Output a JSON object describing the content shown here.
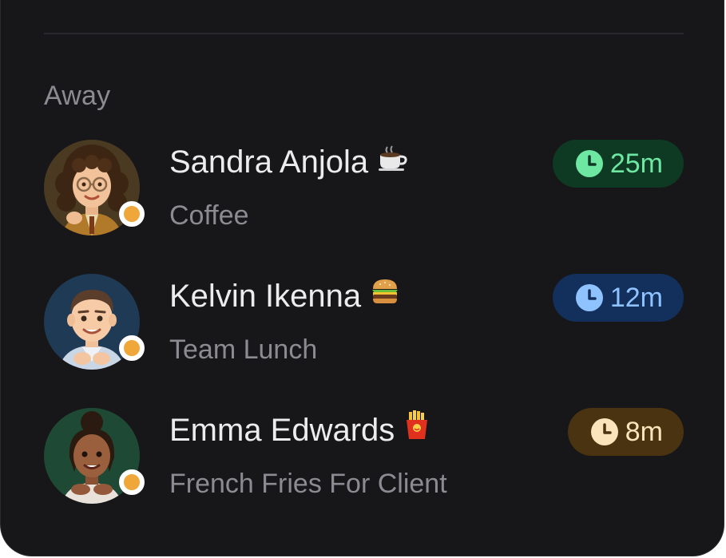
{
  "section": {
    "title": "Away"
  },
  "people": [
    {
      "name": "Sandra Anjola",
      "emoji": "coffee-emoji",
      "status": "Coffee",
      "duration": "25m",
      "pill_bg": "#0e3a24",
      "pill_fg": "#6ee7a2",
      "status_color": "#f0a73a"
    },
    {
      "name": "Kelvin Ikenna",
      "emoji": "burger-emoji",
      "status": "Team Lunch",
      "duration": "12m",
      "pill_bg": "#13305c",
      "pill_fg": "#8fc3ff",
      "status_color": "#f0a73a"
    },
    {
      "name": "Emma Edwards",
      "emoji": "fries-emoji",
      "status": "French Fries For Client",
      "duration": "8m",
      "pill_bg": "#4a3310",
      "pill_fg": "#fbe3bc",
      "status_color": "#f0a73a"
    }
  ],
  "icons": {
    "clock": "clock-icon",
    "status": "away-status-dot"
  }
}
